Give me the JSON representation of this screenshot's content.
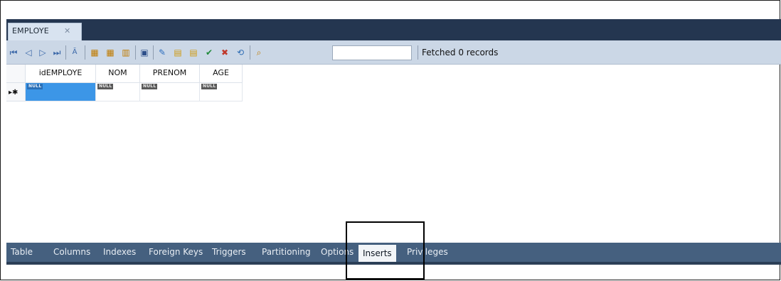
{
  "document_tab": {
    "label": "EMPLOYE",
    "close_symbol": "✕"
  },
  "toolbar": {
    "status_text": "Fetched 0 records",
    "search_value": "",
    "icons": [
      "first-record-icon",
      "previous-record-icon",
      "next-record-icon",
      "last-record-icon",
      "edit-text-icon",
      "sort-ascending-icon",
      "sort-descending-icon",
      "column-filter-icon",
      "save-icon",
      "edit-record-icon",
      "insert-row-icon",
      "delete-row-icon",
      "apply-changes-icon",
      "discard-changes-icon",
      "refresh-icon",
      "search-icon"
    ]
  },
  "grid": {
    "columns": [
      "idEMPLOYE",
      "NOM",
      "PRENOM",
      "AGE"
    ],
    "rows": [
      {
        "marker": "▸✱",
        "cells": [
          "NULL",
          "NULL",
          "NULL",
          "NULL"
        ]
      }
    ]
  },
  "bottom_tabs": [
    {
      "label": "Table"
    },
    {
      "label": "Columns"
    },
    {
      "label": "Indexes"
    },
    {
      "label": "Foreign Keys"
    },
    {
      "label": "Triggers"
    },
    {
      "label": "Partitioning"
    },
    {
      "label": "Options"
    },
    {
      "label": "Inserts",
      "active": true
    },
    {
      "label": "Privileges"
    }
  ],
  "colors": {
    "tabbar": "#243650",
    "toolbar": "#cbd7e6",
    "bottombar": "#45607f",
    "selection": "#3c96e7"
  }
}
